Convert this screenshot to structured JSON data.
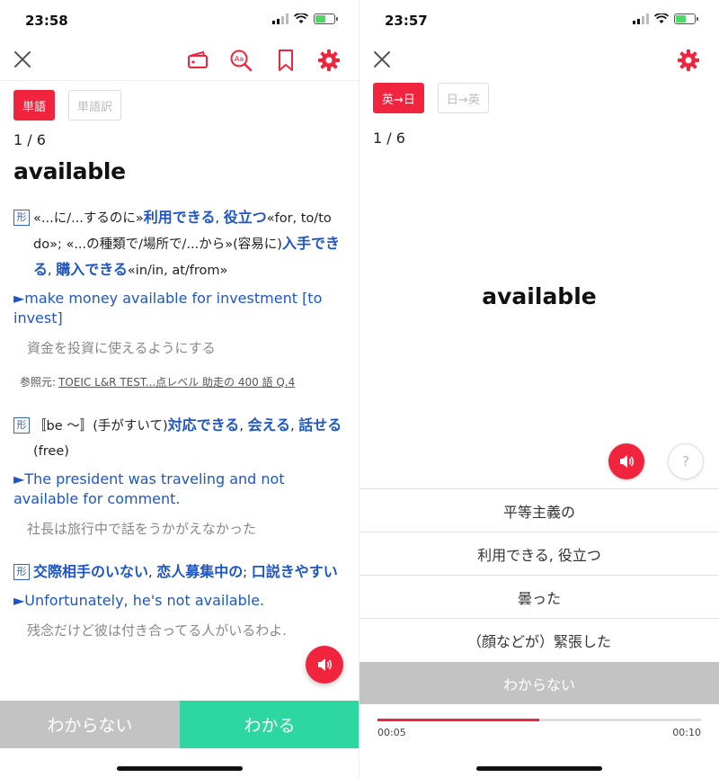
{
  "colors": {
    "accent": "#f0243d",
    "known": "#2ed6a1",
    "link": "#1e56c8",
    "disabled": "#c3c3c3"
  },
  "left": {
    "status_time": "23:58",
    "toolbar": {
      "close_icon": "close-icon",
      "icons": [
        "card-icon",
        "search-word-icon",
        "bookmark-icon",
        "gear-icon"
      ]
    },
    "tabs": [
      {
        "label": "単語",
        "selected": true
      },
      {
        "label": "単語訳",
        "selected": false
      }
    ],
    "counter": "1 / 6",
    "headword": "available",
    "definitions": [
      {
        "pos": "形",
        "parts": [
          {
            "t": "«...に/...するのに»",
            "k": false
          },
          {
            "t": "利用できる",
            "k": true
          },
          {
            "t": ", ",
            "k": false
          },
          {
            "t": "役立つ",
            "k": true
          },
          {
            "t": "«for, to/to do»; «...の種類で/場所で/...から»(容易に)",
            "k": false
          },
          {
            "t": "入手できる",
            "k": true
          },
          {
            "t": ", ",
            "k": false
          },
          {
            "t": "購入できる",
            "k": true
          },
          {
            "t": "«in/in, at/from»",
            "k": false
          }
        ],
        "example": "►make money available for investment [to invest]",
        "translation": "資金を投資に使えるようにする",
        "ref_label": "参照元:",
        "ref_link": "TOEIC L&R TEST...点レベル 助走の 400 語 Q.4"
      },
      {
        "pos": "形",
        "parts": [
          {
            "t": "〚be 〜〛(手がすいて)",
            "k": false
          },
          {
            "t": "対応できる",
            "k": true
          },
          {
            "t": ", ",
            "k": false
          },
          {
            "t": "会える",
            "k": true
          },
          {
            "t": ", ",
            "k": false
          },
          {
            "t": "話せる",
            "k": true
          },
          {
            "t": "(free)",
            "k": false
          }
        ],
        "example": "►The president was traveling and not available for comment.",
        "translation": "社長は旅行中で話をうかがえなかった"
      },
      {
        "pos": "形",
        "parts": [
          {
            "t": "交際相手のいない",
            "k": true
          },
          {
            "t": ", ",
            "k": false
          },
          {
            "t": "恋人募集中の",
            "k": true
          },
          {
            "t": "; ",
            "k": false
          },
          {
            "t": "口説きやすい",
            "k": true
          }
        ],
        "example": "►Unfortunately, he's not available.",
        "translation": "残念だけど彼は付き合ってる人がいるわよ."
      }
    ],
    "speak_icon": "speaker-icon",
    "bottom": {
      "unknown_label": "わからない",
      "known_label": "わかる"
    }
  },
  "right": {
    "status_time": "23:57",
    "toolbar": {
      "close_icon": "close-icon",
      "settings_icon": "gear-icon"
    },
    "tabs": [
      {
        "label": "英→日",
        "selected": true
      },
      {
        "label": "日→英",
        "selected": false
      }
    ],
    "counter": "1 / 6",
    "headword": "available",
    "speak_icon": "speaker-icon",
    "hint_label": "?",
    "choices": [
      "平等主義の",
      "利用できる, 役立つ",
      "曇った",
      "（顔などが）緊張した"
    ],
    "dont_know_label": "わからない",
    "timer": {
      "elapsed": "00:05",
      "total": "00:10",
      "progress": 0.5
    }
  }
}
